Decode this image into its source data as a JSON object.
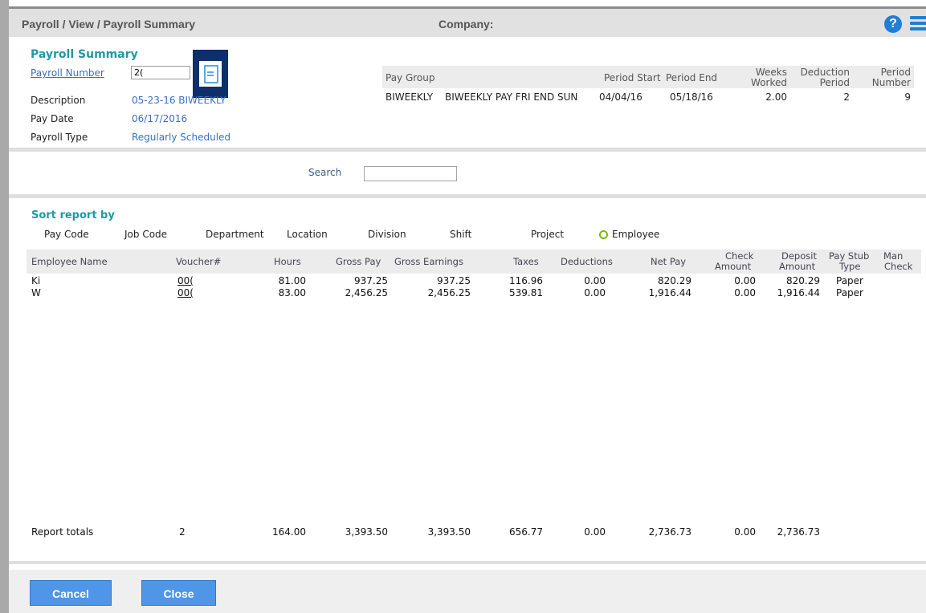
{
  "header": {
    "breadcrumb": "Payroll / View / Payroll Summary",
    "company_label": "Company:",
    "help_icon": "?",
    "menu_icon": "menu-icon"
  },
  "summary": {
    "title": "Payroll Summary",
    "payroll_number_label": "Payroll Number",
    "payroll_number_value": "2(",
    "description_label": "Description",
    "description_value": "05-23-16 BIWEEKLY",
    "pay_date_label": "Pay Date",
    "pay_date_value": "06/17/2016",
    "payroll_type_label": "Payroll Type",
    "payroll_type_value": "Regularly Scheduled"
  },
  "pay_group": {
    "headers": {
      "pay_group": "Pay Group",
      "period_start": "Period Start",
      "period_end": "Period End",
      "weeks_worked_1": "Weeks",
      "weeks_worked_2": "Worked",
      "deduction_period_1": "Deduction",
      "deduction_period_2": "Period",
      "period_number_1": "Period",
      "period_number_2": "Number"
    },
    "row": {
      "code": "BIWEEKLY",
      "name": "BIWEEKLY PAY FRI END SUN",
      "period_start": "04/04/16",
      "period_end": "05/18/16",
      "weeks_worked": "2.00",
      "deduction_period": "2",
      "period_number": "9"
    }
  },
  "search": {
    "label": "Search",
    "value": ""
  },
  "sort": {
    "title": "Sort report by",
    "options": [
      "Pay Code",
      "Job Code",
      "Department",
      "Location",
      "Division",
      "Shift",
      "Project",
      "Employee"
    ],
    "selected": "Employee"
  },
  "table": {
    "headers": {
      "employee_name": "Employee Name",
      "voucher": "Voucher#",
      "hours": "Hours",
      "gross_pay": "Gross Pay",
      "gross_earnings": "Gross Earnings",
      "taxes": "Taxes",
      "deductions": "Deductions",
      "net_pay": "Net Pay",
      "check_amount_1": "Check",
      "check_amount_2": "Amount",
      "deposit_amount_1": "Deposit",
      "deposit_amount_2": "Amount",
      "pay_stub_type_1": "Pay Stub",
      "pay_stub_type_2": "Type",
      "man_check_1": "Man",
      "man_check_2": "Check"
    },
    "rows": [
      {
        "name": "Ki",
        "voucher": "00(",
        "hours": "81.00",
        "gross_pay": "937.25",
        "gross_earnings": "937.25",
        "taxes": "116.96",
        "deductions": "0.00",
        "net_pay": "820.29",
        "check_amount": "0.00",
        "deposit_amount": "820.29",
        "pay_stub_type": "Paper"
      },
      {
        "name": "W",
        "voucher": "00(",
        "hours": "83.00",
        "gross_pay": "2,456.25",
        "gross_earnings": "2,456.25",
        "taxes": "539.81",
        "deductions": "0.00",
        "net_pay": "1,916.44",
        "check_amount": "0.00",
        "deposit_amount": "1,916.44",
        "pay_stub_type": "Paper"
      }
    ],
    "totals": {
      "label": "Report totals",
      "count": "2",
      "hours": "164.00",
      "gross_pay": "3,393.50",
      "gross_earnings": "3,393.50",
      "taxes": "656.77",
      "deductions": "0.00",
      "net_pay": "2,736.73",
      "check_amount": "0.00",
      "deposit_amount": "2,736.73"
    }
  },
  "buttons": {
    "cancel": "Cancel",
    "close": "Close"
  },
  "colors": {
    "accent": "#1f9aa3",
    "link": "#3a6fc4",
    "button": "#4f95e8",
    "doc_button": "#0f2f6b"
  }
}
